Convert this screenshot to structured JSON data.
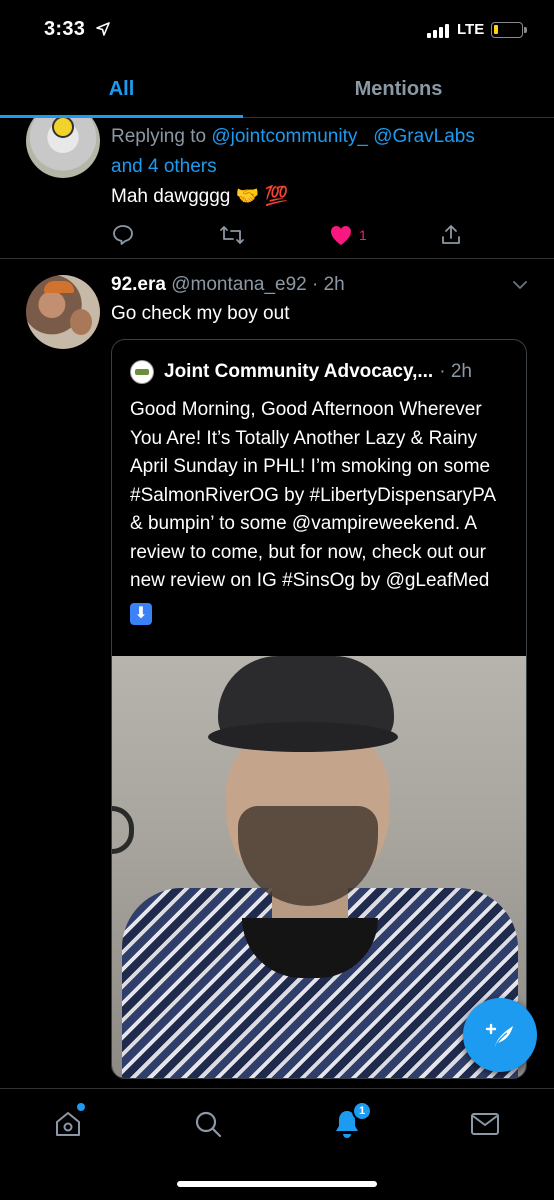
{
  "status_bar": {
    "time": "3:33",
    "network": "LTE"
  },
  "tabs": [
    {
      "label": "All",
      "active": true
    },
    {
      "label": "Mentions",
      "active": false
    }
  ],
  "tweet1": {
    "replying_prefix": "Replying to ",
    "mention1": "@jointcommunity_",
    "mention2": "@GravLabs",
    "others": "and 4 others",
    "text": "Mah dawgggg 🤝 💯",
    "like_count": "1"
  },
  "tweet2": {
    "display_name": "92.era",
    "handle_time": "@montana_e92 · 2h",
    "text": "Go check my boy out",
    "quote": {
      "display_name": "Joint Community Advocacy,...",
      "time": "· 2h",
      "body": "Good Morning, Good Afternoon Wherever You Are! It’s Totally Another Lazy & Rainy April Sunday in PHL! I’m smoking on some #SalmonRiverOG by #LibertyDispensaryPA & bumpin’ to some @vampireweekend. A review to come, but for now, check out our new review on IG #SinsOg by @gLeafMed",
      "body_emoji": "⬇"
    }
  },
  "bottom_nav": {
    "notifications_badge": "1"
  },
  "colors": {
    "accent": "#1d9bf0",
    "like": "#f91880",
    "muted": "#8b98a5",
    "background": "#000000"
  },
  "icons": [
    "location-arrow-icon",
    "signal-icon",
    "battery-icon",
    "reply-icon",
    "retweet-icon",
    "heart-icon",
    "share-icon",
    "chevron-down-icon",
    "compose-icon",
    "home-icon",
    "search-icon",
    "bell-icon",
    "mail-icon"
  ]
}
